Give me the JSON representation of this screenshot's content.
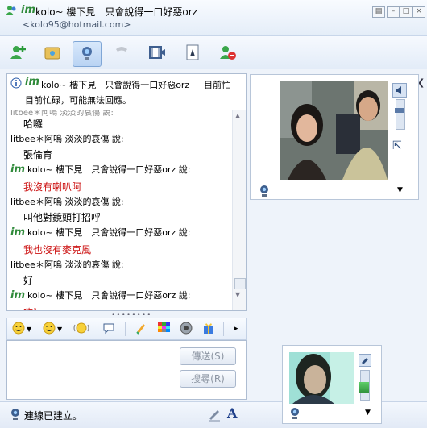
{
  "window": {
    "title": "kolo~ 樓下見　只會說得一口好惡orz",
    "subtitle": "<kolo95@hotmail.com>"
  },
  "toolbar": {
    "icons": [
      "invite-contact-icon",
      "send-file-icon",
      "webcam-icon",
      "call-icon",
      "video-icon",
      "games-icon",
      "block-icon"
    ]
  },
  "status_banner": {
    "name": "kolo~ 樓下見　只會說得一口好惡orz",
    "message": "目前忙碌，可能無法回應。"
  },
  "messages": [
    {
      "type": "body",
      "text": "哈囉",
      "red": false
    },
    {
      "type": "header",
      "text": "litbee＊阿嗚 淡淡的哀傷 說:",
      "im": false
    },
    {
      "type": "body",
      "text": "張倫育",
      "red": false
    },
    {
      "type": "header",
      "text": "kolo~ 樓下見　只會說得一口好惡orz 說:",
      "im": true
    },
    {
      "type": "body",
      "text": "我沒有喇叭阿",
      "red": true
    },
    {
      "type": "header",
      "text": "litbee＊阿嗚 淡淡的哀傷 說:",
      "im": false
    },
    {
      "type": "body",
      "text": "叫他對鏡頭打招呼",
      "red": false
    },
    {
      "type": "header",
      "text": "kolo~ 樓下見　只會說得一口好惡orz 說:",
      "im": true
    },
    {
      "type": "body",
      "text": "我也沒有麥克風",
      "red": true
    },
    {
      "type": "header",
      "text": "litbee＊阿嗚 淡淡的哀傷 說:",
      "im": false
    },
    {
      "type": "body",
      "text": "好",
      "red": false
    },
    {
      "type": "header",
      "text": "kolo~ 樓下見　只會說得一口好惡orz 說:",
      "im": true
    },
    {
      "type": "body",
      "text": "嗨]",
      "red": true
    }
  ],
  "input": {
    "value": "",
    "send_label": "傳送(S)",
    "search_label": "搜尋(R)"
  },
  "statusbar": {
    "text": "連線已建立。"
  },
  "colors": {
    "message_red": "#cc1111",
    "im_logo": "#2f8a3a"
  }
}
